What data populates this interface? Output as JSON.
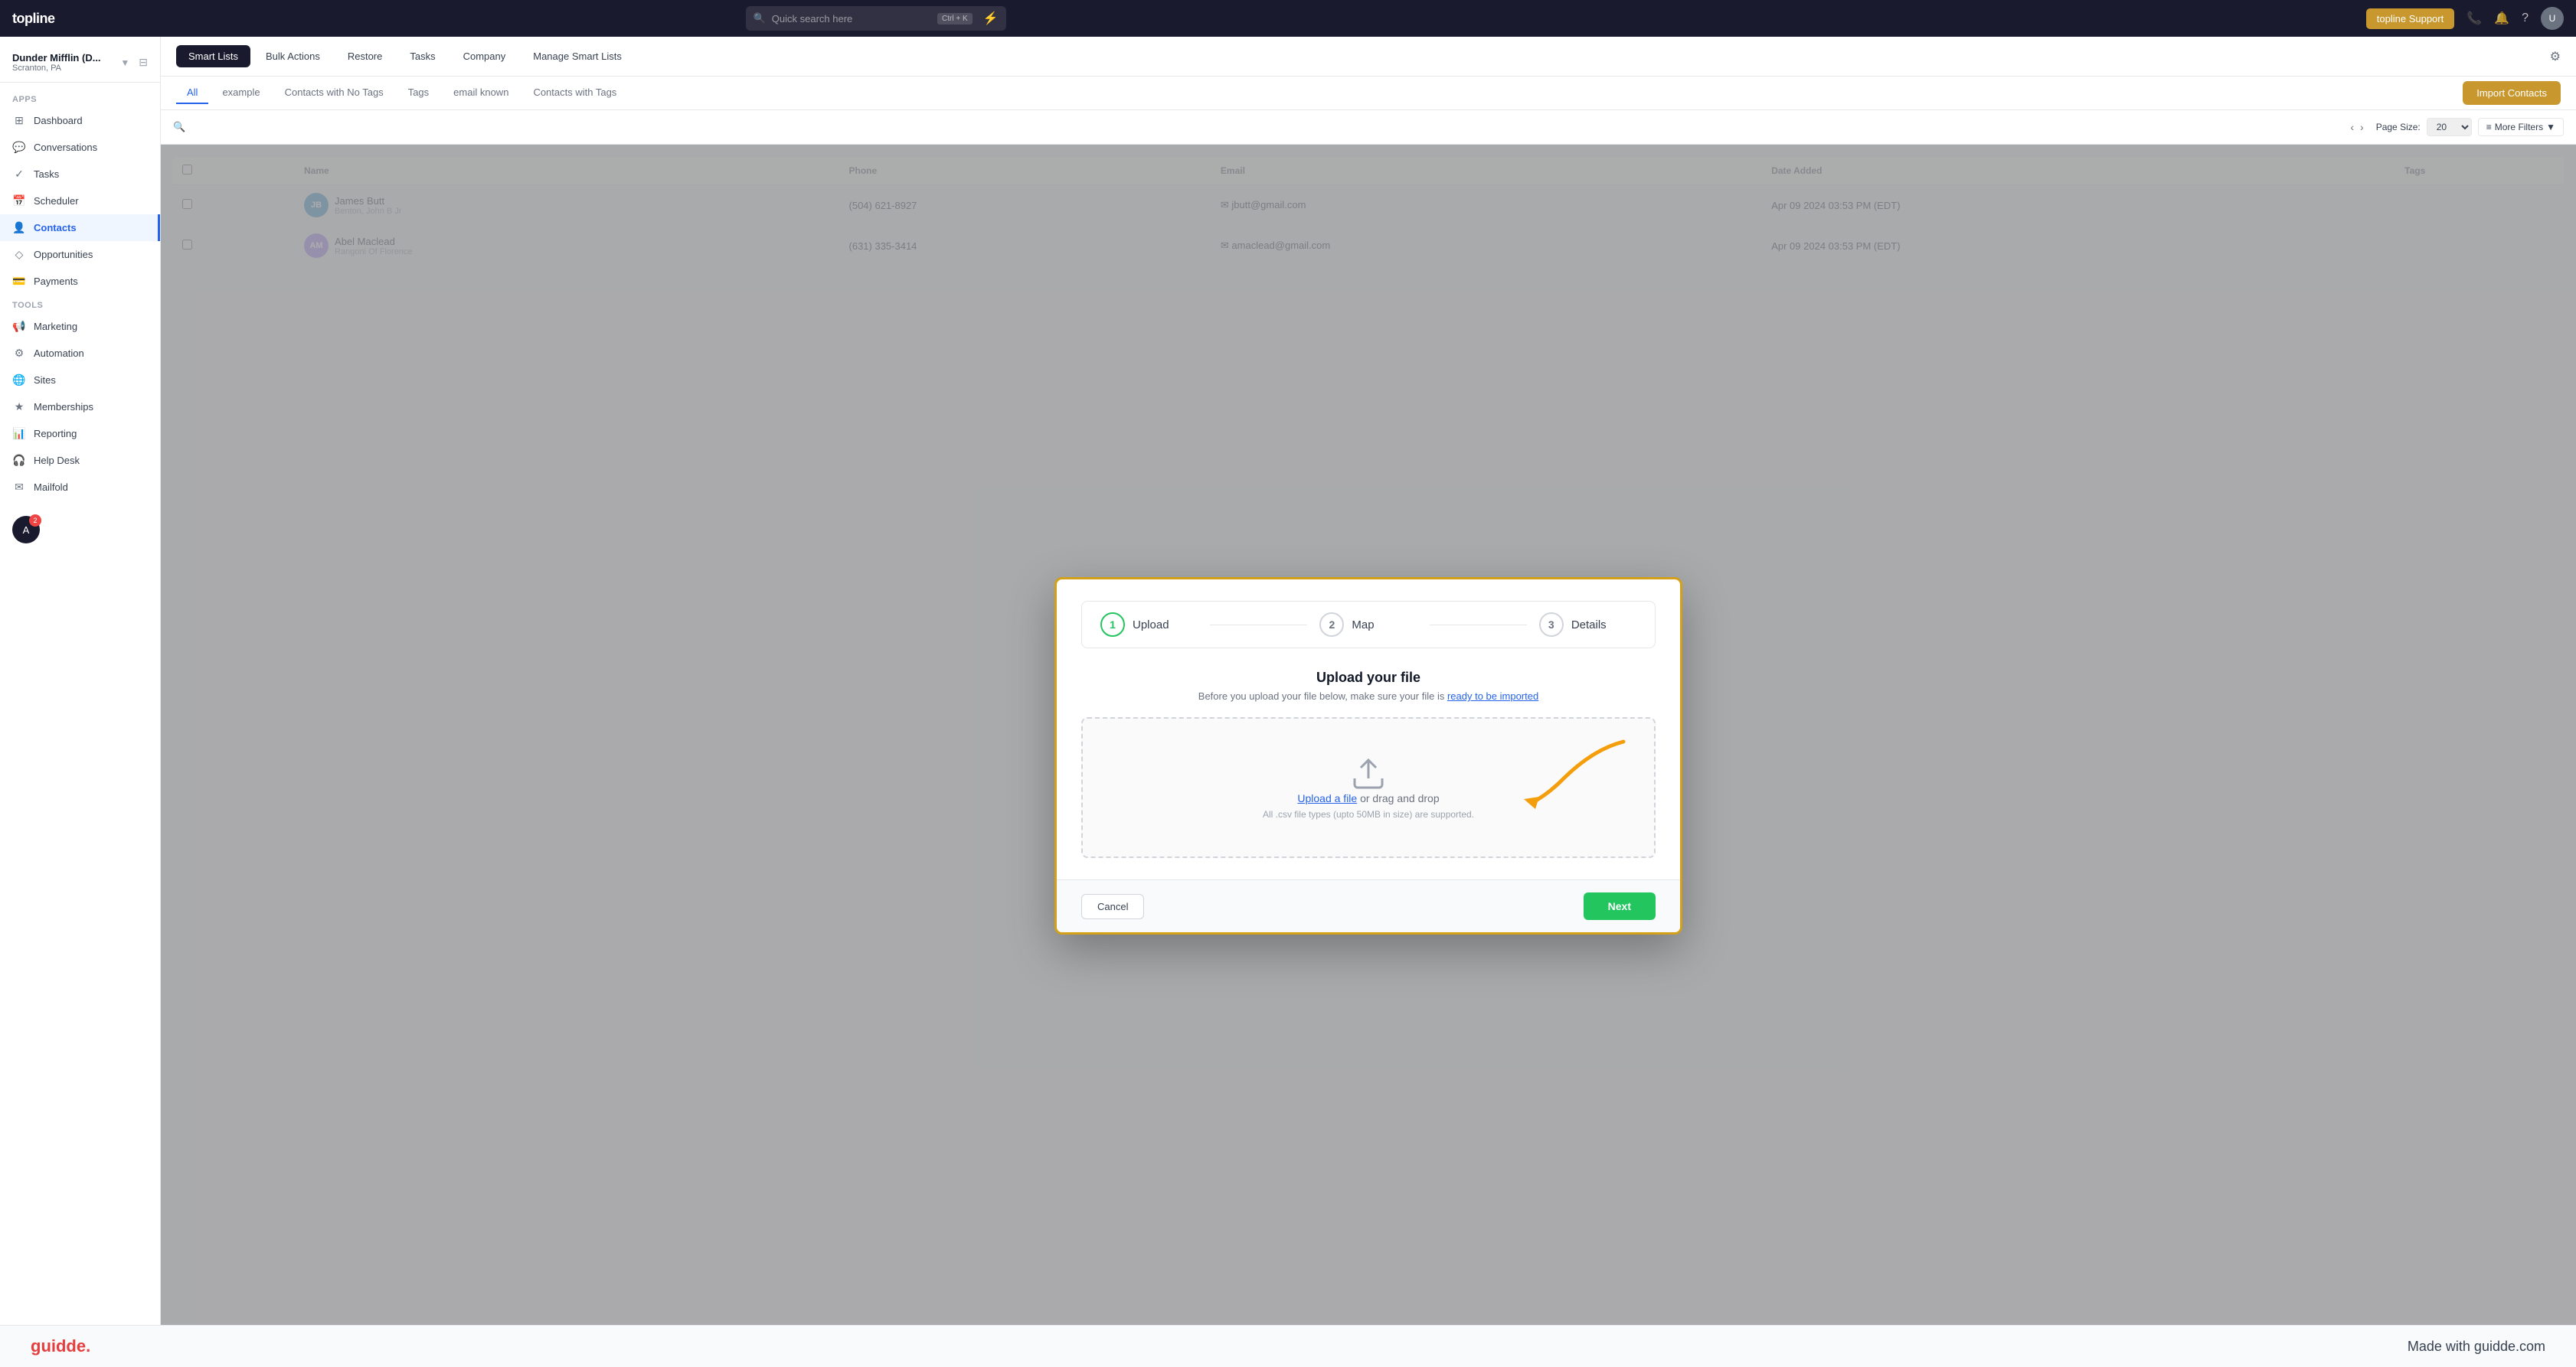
{
  "app": {
    "logo": "topline",
    "search_placeholder": "Quick search here",
    "search_shortcut": "Ctrl + K",
    "support_button": "topline Support",
    "bolt_icon": "⚡"
  },
  "workspace": {
    "name": "Dunder Mifflin (D...",
    "location": "Scranton, PA"
  },
  "sidebar": {
    "apps_label": "Apps",
    "tools_label": "Tools",
    "items": [
      {
        "id": "dashboard",
        "label": "Dashboard",
        "icon": "⊞"
      },
      {
        "id": "conversations",
        "label": "Conversations",
        "icon": "💬"
      },
      {
        "id": "tasks",
        "label": "Tasks",
        "icon": "✓"
      },
      {
        "id": "scheduler",
        "label": "Scheduler",
        "icon": "📅"
      },
      {
        "id": "contacts",
        "label": "Contacts",
        "icon": "👤"
      },
      {
        "id": "opportunities",
        "label": "Opportunities",
        "icon": "◇"
      },
      {
        "id": "payments",
        "label": "Payments",
        "icon": "💳"
      },
      {
        "id": "marketing",
        "label": "Marketing",
        "icon": "📢"
      },
      {
        "id": "automation",
        "label": "Automation",
        "icon": "⚙"
      },
      {
        "id": "sites",
        "label": "Sites",
        "icon": "🌐"
      },
      {
        "id": "memberships",
        "label": "Memberships",
        "icon": "★"
      },
      {
        "id": "reporting",
        "label": "Reporting",
        "icon": "📊"
      },
      {
        "id": "helpdesk",
        "label": "Help Desk",
        "icon": "🎧"
      },
      {
        "id": "mailfold",
        "label": "Mailfold",
        "icon": "✉"
      }
    ]
  },
  "subnav": {
    "items": [
      {
        "label": "Smart Lists",
        "active": true
      },
      {
        "label": "Bulk Actions",
        "active": false
      },
      {
        "label": "Restore",
        "active": false
      },
      {
        "label": "Tasks",
        "active": false
      },
      {
        "label": "Company",
        "active": false
      },
      {
        "label": "Manage Smart Lists",
        "active": false
      }
    ]
  },
  "tabs": {
    "items": [
      {
        "label": "All",
        "active": true
      },
      {
        "label": "example",
        "active": false
      },
      {
        "label": "Contacts with No Tags",
        "active": false
      },
      {
        "label": "Tags",
        "active": false
      },
      {
        "label": "email known",
        "active": false
      },
      {
        "label": "Contacts with Tags",
        "active": false
      }
    ],
    "import_button": "Import Contacts"
  },
  "filter_bar": {
    "page_size_label": "Page Size:",
    "page_size_value": "20",
    "more_filters": "More Filters"
  },
  "modal": {
    "title": "Upload your file",
    "subtitle": "Before you upload your file below, make sure your file is",
    "link_text": "ready to be imported",
    "dropzone_action": "or drag and drop",
    "dropzone_link": "Upload a file",
    "dropzone_hint": "All .csv file types (upto 50MB in size) are supported.",
    "cancel_label": "Cancel",
    "next_label": "Next",
    "steps": [
      {
        "number": "1",
        "label": "Upload",
        "active": true
      },
      {
        "number": "2",
        "label": "Map",
        "active": false
      },
      {
        "number": "3",
        "label": "Details",
        "active": false
      }
    ]
  },
  "table": {
    "rows": [
      {
        "initials": "JB",
        "color": "#4b9cd3",
        "name": "James Butt",
        "sub": "Benton, John B Jr",
        "phone": "(504) 621-8927",
        "email": "jbutt@gmail.com",
        "date": "Apr 09 2024 03:53 PM (EDT)"
      },
      {
        "initials": "AM",
        "color": "#a78bfa",
        "name": "Abel Maclead",
        "sub": "Rangoni Of Florence",
        "phone": "(631) 335-3414",
        "email": "amaclead@gmail.com",
        "date": "Apr 09 2024 03:53 PM (EDT)"
      }
    ]
  },
  "guidde": {
    "logo": "guidde.",
    "tagline": "Made with guidde.com"
  }
}
